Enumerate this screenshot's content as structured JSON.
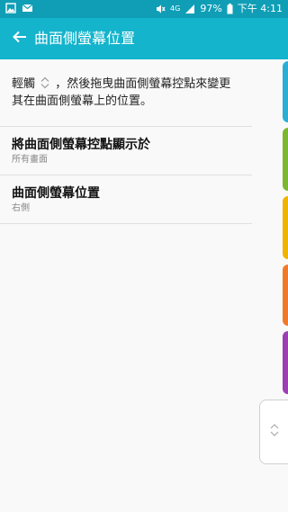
{
  "status_bar": {
    "left_icons": [
      "gallery-icon",
      "mail-icon"
    ],
    "network": "4G",
    "battery": "97%",
    "time": "下午 4:11"
  },
  "app_bar": {
    "title": "曲面側螢幕位置"
  },
  "instruction": {
    "part1": "輕觸",
    "part2": "，然後拖曳曲面側螢幕控點來變更其在曲面側螢幕上的位置。"
  },
  "settings": [
    {
      "title": "將曲面側螢幕控點顯示於",
      "subtitle": "所有畫面"
    },
    {
      "title": "曲面側螢幕位置",
      "subtitle": "右側"
    }
  ],
  "colors": {
    "status_bar": "#0f9eb6",
    "app_bar": "#14b4cc",
    "edge_tabs": [
      "#2aaed4",
      "#7cb82f",
      "#f0b400",
      "#f07a2a",
      "#9b3fb3"
    ]
  }
}
